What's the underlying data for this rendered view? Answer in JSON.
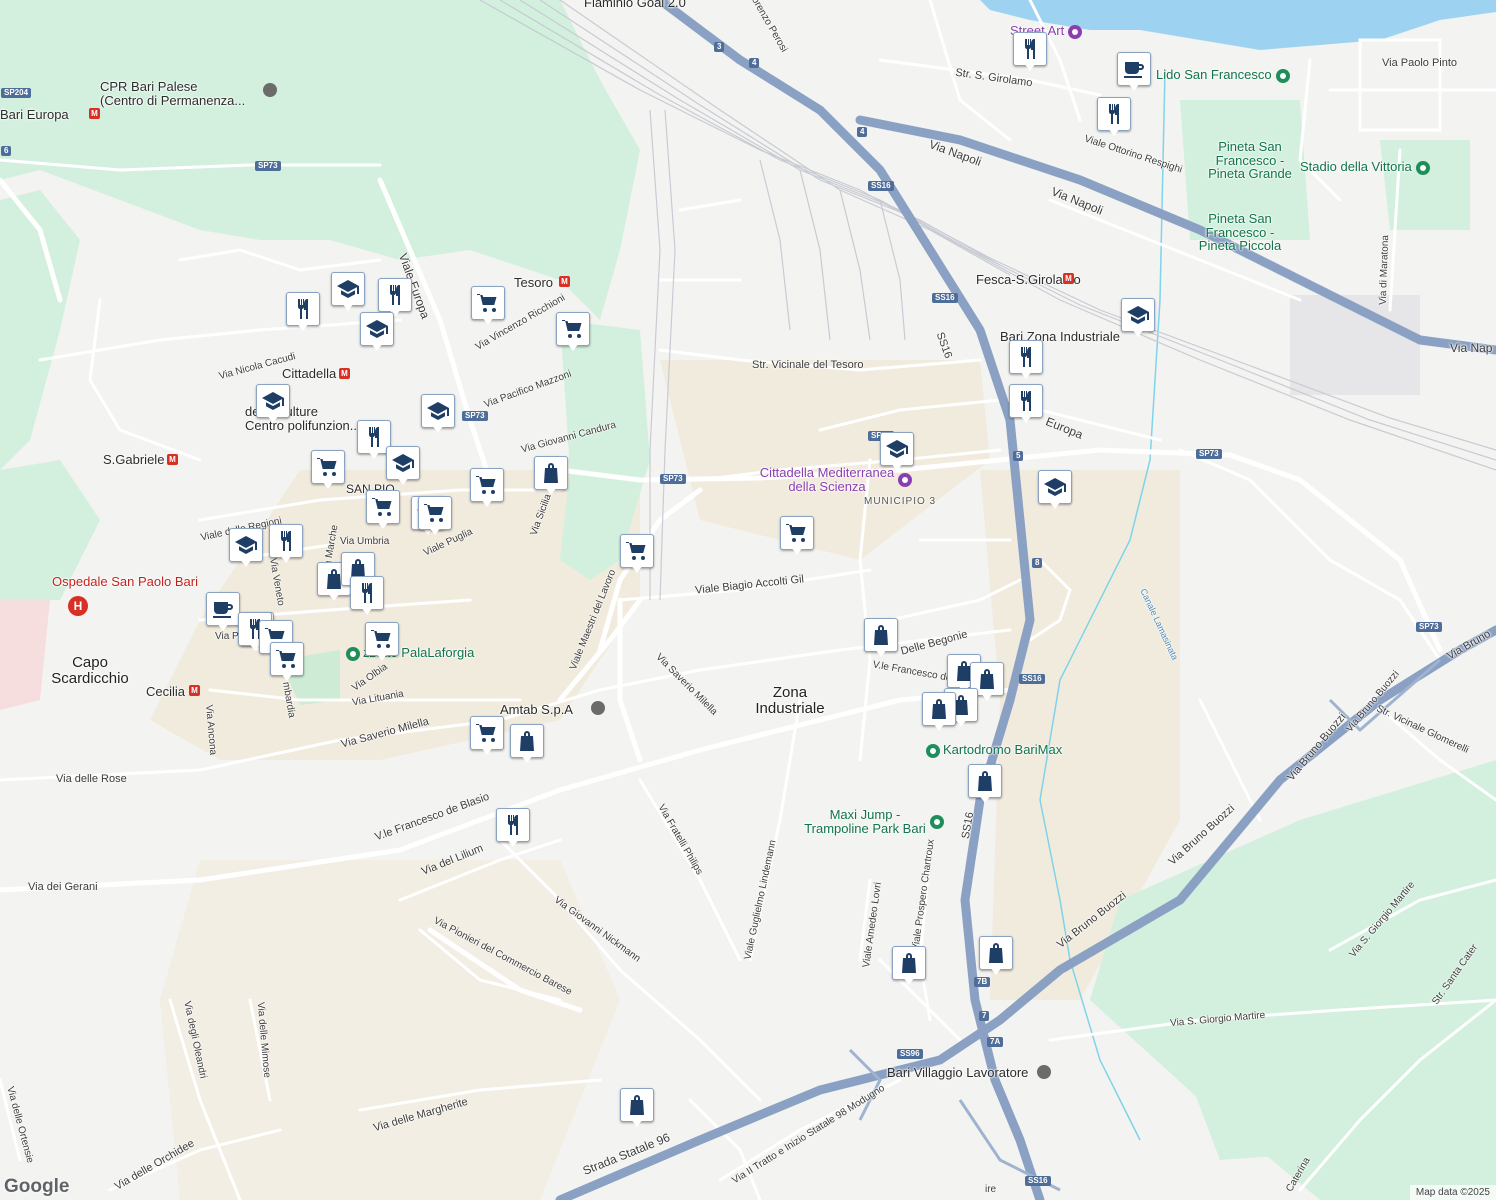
{
  "colors": {
    "land": "#f3f3f1",
    "park": "#cdeed9",
    "water": "#9dd3f0",
    "highway": "#8ba1c4",
    "road": "#ffffff",
    "marker_icon": "#1f3e66",
    "green_label": "#11744a",
    "metro": "#d93025"
  },
  "map": {
    "districts": [
      {
        "id": "zona-industriale",
        "text": "Zona\nIndustriale"
      },
      {
        "id": "capo-scardicchio",
        "text": "Capo\nScardicchio"
      }
    ],
    "places": [
      {
        "id": "cpr",
        "text": "CPR Bari Palese\n(Centro di Permanenza..."
      },
      {
        "id": "centro-culture",
        "text": "delle Culture\nCentro polifunzion..."
      },
      {
        "id": "amtab",
        "text": "Amtab S.p.A"
      },
      {
        "id": "municipio",
        "text": "MUNICIPIO 3"
      },
      {
        "id": "bari-zona-ind",
        "text": "Bari Zona Industriale"
      },
      {
        "id": "villaggio",
        "text": "Bari Villaggio Lavoratore"
      },
      {
        "id": "cecilia",
        "text": "Cecilia"
      },
      {
        "id": "tesoro",
        "text": "Tesoro"
      },
      {
        "id": "cittadella",
        "text": "Cittadella"
      },
      {
        "id": "s-gabriele",
        "text": "S.Gabriele"
      },
      {
        "id": "fesca",
        "text": "Fesca-S.Girolamo"
      },
      {
        "id": "bari-europa",
        "text": "Bari Europa"
      },
      {
        "id": "flaminio",
        "text": "Flaminio Goal 2.0"
      },
      {
        "id": "san-pio",
        "text": "SAN PIO"
      }
    ],
    "green_places": [
      {
        "id": "lido",
        "text": "Lido San Francesco"
      },
      {
        "id": "pineta-grande",
        "text": "Pineta San\nFrancesco -\nPineta Grande"
      },
      {
        "id": "stadio",
        "text": "Stadio della Vittoria"
      },
      {
        "id": "pineta-piccola",
        "text": "Pineta San\nFrancesco -\nPineta Piccola"
      },
      {
        "id": "kartodromo",
        "text": "Kartodromo BariMax"
      },
      {
        "id": "maxi-jump",
        "text": "Maxi Jump -\nTrampoline Park Bari"
      },
      {
        "id": "palalaforgia",
        "text": "zzetto PalaLaforgia"
      }
    ],
    "red_places": [
      {
        "id": "ospedale",
        "text": "Ospedale San Paolo Bari"
      }
    ],
    "purple_places": [
      {
        "id": "street-art",
        "text": "Street Art"
      },
      {
        "id": "cittadella-scienza",
        "text": "Cittadella Mediterranea\ndella Scienza"
      }
    ],
    "streets": [
      {
        "id": "via-napoli-1",
        "text": "Via Napoli"
      },
      {
        "id": "via-napoli-2",
        "text": "Via Napoli"
      },
      {
        "id": "via-napoli-3",
        "text": "Via Nap"
      },
      {
        "id": "via-paolo-pinto",
        "text": "Via Paolo Pinto"
      },
      {
        "id": "str-s-girolamo",
        "text": "Str. S. Girolamo"
      },
      {
        "id": "respighi",
        "text": "Viale Ottorino Respighi"
      },
      {
        "id": "maratona",
        "text": "Via di Maratona"
      },
      {
        "id": "str-vicinale-tesoro",
        "text": "Str. Vicinale del Tesoro"
      },
      {
        "id": "europa-1",
        "text": "Viale Europa"
      },
      {
        "id": "europa-2",
        "text": "Europa"
      },
      {
        "id": "ricchioni",
        "text": "Via Vincenzo Ricchioni"
      },
      {
        "id": "mazzoni",
        "text": "Via Pacifico Mazzoni"
      },
      {
        "id": "candura",
        "text": "Via Giovanni Candura"
      },
      {
        "id": "cacudi",
        "text": "Via Nicola Cacudi"
      },
      {
        "id": "regioni",
        "text": "Viale delle Regioni"
      },
      {
        "id": "umbria",
        "text": "Via Umbria"
      },
      {
        "id": "puglia",
        "text": "Viale Puglia"
      },
      {
        "id": "sicilia",
        "text": "Via Sicilia"
      },
      {
        "id": "marche",
        "text": "Via Marche"
      },
      {
        "id": "veneto",
        "text": "Via Veneto"
      },
      {
        "id": "via-pi",
        "text": "Via Pi"
      },
      {
        "id": "olbia",
        "text": "Via Olbia"
      },
      {
        "id": "lituania",
        "text": "Via Lituania"
      },
      {
        "id": "lombardia",
        "text": "mbardia"
      },
      {
        "id": "ancona",
        "text": "Via Ancona"
      },
      {
        "id": "accolti-gil",
        "text": "Viale Biagio Accolti Gil"
      },
      {
        "id": "maestri-lavoro",
        "text": "Viale Maestri del Lavoro"
      },
      {
        "id": "saverio-milella-1",
        "text": "Via Saverio Milella"
      },
      {
        "id": "saverio-milella-2",
        "text": "Via Saverio Milella"
      },
      {
        "id": "begonie",
        "text": "Delle Begonie"
      },
      {
        "id": "francesco-b",
        "text": "V.le Francesco de B"
      },
      {
        "id": "francesco-blasio",
        "text": "V.le Francesco de Blasio"
      },
      {
        "id": "rose",
        "text": "Via delle Rose"
      },
      {
        "id": "lilium",
        "text": "Via del Lilium"
      },
      {
        "id": "gerani",
        "text": "Via dei Gerani"
      },
      {
        "id": "fratelli-philips",
        "text": "Via Fratelli Philips"
      },
      {
        "id": "lindemann",
        "text": "Viale Guglielmo Lindemann"
      },
      {
        "id": "amedeo-lovri",
        "text": "Viale Amedeo Lovri"
      },
      {
        "id": "chartroux",
        "text": "Viale Prospero Chartroux"
      },
      {
        "id": "nickmann",
        "text": "Via Giovanni Nickmann"
      },
      {
        "id": "pionieri",
        "text": "Via Pionieri del Commercio Barese"
      },
      {
        "id": "oleandri",
        "text": "Via degli Oleandri"
      },
      {
        "id": "mimose",
        "text": "Via delle Mimose"
      },
      {
        "id": "margherite",
        "text": "Via delle Margherite"
      },
      {
        "id": "orchidee",
        "text": "Via delle Orchidee"
      },
      {
        "id": "ortensie",
        "text": "Via delle Ortensie"
      },
      {
        "id": "statale-96",
        "text": "Strada Statale 96"
      },
      {
        "id": "tratto-98",
        "text": "Via II Tratto e Inizio Statale 98 Modugno"
      },
      {
        "id": "buozzi-1",
        "text": "Via Bruno Buozzi"
      },
      {
        "id": "buozzi-2",
        "text": "Via Bruno Buozzi"
      },
      {
        "id": "buozzi-3",
        "text": "Via Bruno Buozzi"
      },
      {
        "id": "buozzi-4",
        "text": "Via Bruno Buozzi"
      },
      {
        "id": "buozzi-5",
        "text": "Via Bruno"
      },
      {
        "id": "glomerelli",
        "text": "Str. Vicinale Glomerelli"
      },
      {
        "id": "s-giorgio-1",
        "text": "Via S. Giorgio Martire"
      },
      {
        "id": "s-giorgio-2",
        "text": "Via S. Giorgio Martire"
      },
      {
        "id": "santa-caterina",
        "text": "Str. Santa Cater"
      },
      {
        "id": "caterina",
        "text": "Caterina"
      },
      {
        "id": "perosi",
        "text": "orenzo Perosi"
      },
      {
        "id": "lamasinata",
        "text": "Canale Lamasinata"
      },
      {
        "id": "ss16-label",
        "text": "SS16"
      },
      {
        "id": "ss16-label-2",
        "text": "SS16"
      },
      {
        "id": "ire",
        "text": "ire"
      }
    ],
    "shields": [
      {
        "id": "sp204",
        "text": "SP204"
      },
      {
        "id": "sp73-a",
        "text": "SP73"
      },
      {
        "id": "sp73-b",
        "text": "SP73"
      },
      {
        "id": "sp73-c",
        "text": "SP73"
      },
      {
        "id": "sp73-d",
        "text": "SP73"
      },
      {
        "id": "sp73-e",
        "text": "SP73"
      },
      {
        "id": "sp73-f",
        "text": "SP73"
      },
      {
        "id": "ss16-a",
        "text": "SS16"
      },
      {
        "id": "ss16-b",
        "text": "SS16"
      },
      {
        "id": "ss16-c",
        "text": "SS16"
      },
      {
        "id": "ss16-d",
        "text": "SS16"
      },
      {
        "id": "ss96",
        "text": "SS96"
      },
      {
        "id": "x3",
        "text": "3"
      },
      {
        "id": "x4a",
        "text": "4"
      },
      {
        "id": "x4b",
        "text": "4"
      },
      {
        "id": "x5",
        "text": "5"
      },
      {
        "id": "x8",
        "text": "8"
      },
      {
        "id": "x7b",
        "text": "7B"
      },
      {
        "id": "x7",
        "text": "7"
      },
      {
        "id": "x7a",
        "text": "7A"
      },
      {
        "id": "x6",
        "text": "6"
      }
    ],
    "markers": [
      {
        "type": "restaurant"
      },
      {
        "type": "cafe"
      },
      {
        "type": "restaurant"
      },
      {
        "type": "school"
      },
      {
        "type": "restaurant"
      },
      {
        "type": "restaurant"
      },
      {
        "type": "school"
      },
      {
        "type": "school"
      },
      {
        "type": "restaurant"
      },
      {
        "type": "school"
      },
      {
        "type": "restaurant"
      },
      {
        "type": "school"
      },
      {
        "type": "grocery"
      },
      {
        "type": "grocery"
      },
      {
        "type": "school"
      },
      {
        "type": "school"
      },
      {
        "type": "restaurant"
      },
      {
        "type": "grocery"
      },
      {
        "type": "school"
      },
      {
        "type": "grocery"
      },
      {
        "type": "shopping"
      },
      {
        "type": "grocery"
      },
      {
        "type": "school"
      },
      {
        "type": "grocery"
      },
      {
        "type": "shopping"
      },
      {
        "type": "shopping"
      },
      {
        "type": "school"
      },
      {
        "type": "restaurant"
      },
      {
        "type": "cafe"
      },
      {
        "type": "grocery"
      },
      {
        "type": "restaurant"
      },
      {
        "type": "grocery"
      },
      {
        "type": "grocery"
      },
      {
        "type": "grocery"
      },
      {
        "type": "grocery"
      },
      {
        "type": "grocery"
      },
      {
        "type": "shopping"
      },
      {
        "type": "grocery"
      },
      {
        "type": "shopping"
      },
      {
        "type": "shopping"
      },
      {
        "type": "shopping"
      },
      {
        "type": "shopping"
      },
      {
        "type": "shopping"
      },
      {
        "type": "shopping"
      },
      {
        "type": "shopping"
      },
      {
        "type": "shopping"
      },
      {
        "type": "restaurant"
      },
      {
        "type": "shopping"
      },
      {
        "type": "restaurant"
      }
    ],
    "google_logo": "Google",
    "attribution": "Map data ©2025"
  }
}
